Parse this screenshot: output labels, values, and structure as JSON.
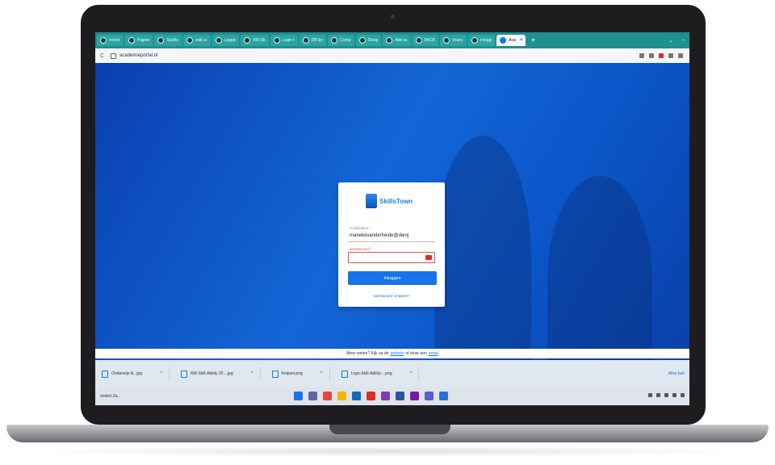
{
  "browser": {
    "tabs": [
      {
        "label": "Instelr"
      },
      {
        "label": "Pagina"
      },
      {
        "label": "Startfu"
      },
      {
        "label": "skill sc"
      },
      {
        "label": "Legals"
      },
      {
        "label": "RM-Sk"
      },
      {
        "label": "Login t"
      },
      {
        "label": "DB lijn"
      },
      {
        "label": "Comp"
      },
      {
        "label": "Desig"
      },
      {
        "label": "Abd sc"
      },
      {
        "label": "BACK"
      },
      {
        "label": "Inlanc"
      },
      {
        "label": "Inloggi"
      },
      {
        "label": "Aca",
        "active": true
      }
    ],
    "new_tab_symbol": "+",
    "window_controls": [
      "⌄",
      "–"
    ],
    "url": "academieportal.nl"
  },
  "login": {
    "brand": "SkillsTown",
    "email_label": "e-mailadres *",
    "email_value": "mariekevanderheide@dienj",
    "password_label": "wachtwoord *",
    "button_label": "Inloggen",
    "forgot_link": "wachtwoord vergeten?"
  },
  "footer": {
    "prefix": "Meer weten? Kijk op de",
    "link1": "website",
    "middle": "of stuur een",
    "link2": "email"
  },
  "downloads": {
    "items": [
      {
        "name": "Onderwijs kl...jpg"
      },
      {
        "name": "RM-Skill-Ability 20....jpg"
      },
      {
        "name": "Knipsel.png"
      },
      {
        "name": "Logo-Skill-Ability-...png"
      }
    ],
    "show_all": "Alles bek"
  },
  "taskbar": {
    "left_text": "ondert Za...",
    "apps": [
      {
        "icon": "windows-start-icon",
        "color": "#1a73e8"
      },
      {
        "icon": "chat-icon",
        "color": "#6264a7"
      },
      {
        "icon": "chrome-icon",
        "color": "#e8453c"
      },
      {
        "icon": "folder-icon",
        "color": "#f4b400"
      },
      {
        "icon": "outlook-icon",
        "color": "#0f6cbd"
      },
      {
        "icon": "acrobat-icon",
        "color": "#d93025"
      },
      {
        "icon": "app-icon",
        "color": "#7a3db8"
      },
      {
        "icon": "word-icon",
        "color": "#2b579a"
      },
      {
        "icon": "onenote-icon",
        "color": "#7719aa"
      },
      {
        "icon": "teams-icon",
        "color": "#5b5fc7"
      },
      {
        "icon": "app2-icon",
        "color": "#2a6fd6"
      }
    ]
  }
}
